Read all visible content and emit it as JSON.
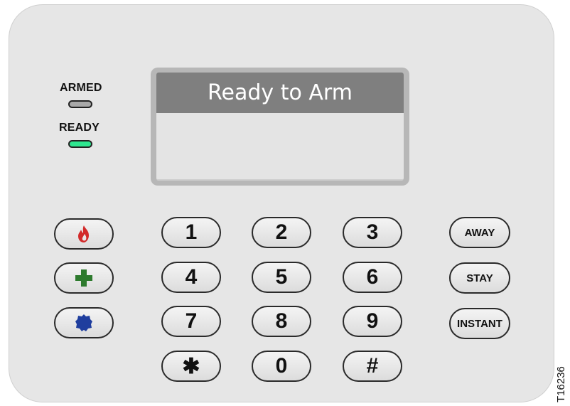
{
  "indicators": {
    "armed_label": "ARMED",
    "ready_label": "READY"
  },
  "display": {
    "line1": "Ready to Arm",
    "line2": ""
  },
  "emergency_keys": [
    {
      "name": "fire",
      "icon": "fire-icon",
      "color": "#d22a2a"
    },
    {
      "name": "medical",
      "icon": "medical-cross-icon",
      "color": "#2d7a2d"
    },
    {
      "name": "police",
      "icon": "police-shield-icon",
      "color": "#1f3e9e"
    }
  ],
  "keypad": {
    "k1": "1",
    "k2": "2",
    "k3": "3",
    "k4": "4",
    "k5": "5",
    "k6": "6",
    "k7": "7",
    "k8": "8",
    "k9": "9",
    "kstar": "✱",
    "k0": "0",
    "khash": "#"
  },
  "function_keys": {
    "away": "AWAY",
    "stay": "STAY",
    "instant": "INSTANT"
  },
  "figure_code": "T16236"
}
